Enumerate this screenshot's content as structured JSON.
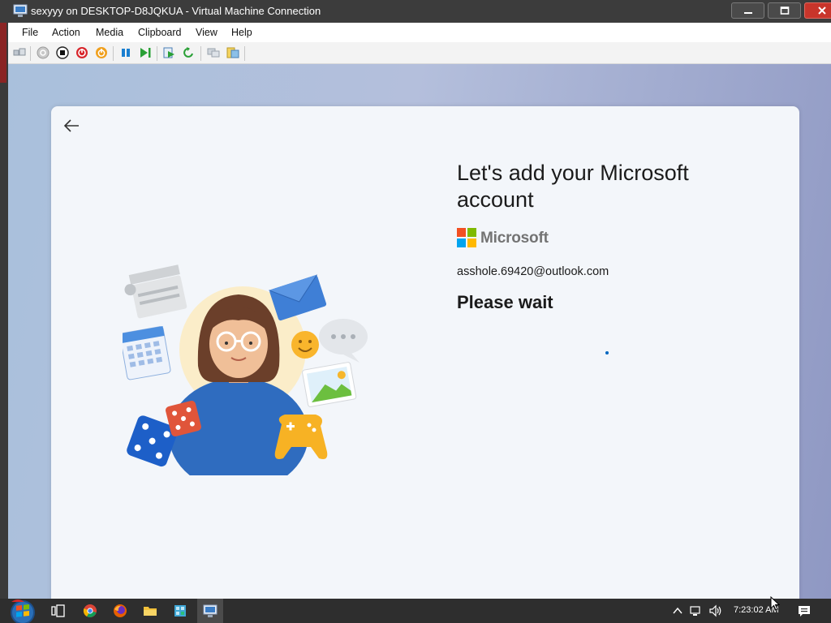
{
  "window": {
    "title": "sexyyy on DESKTOP-D8JQKUA - Virtual Machine Connection",
    "controls": [
      "minimize",
      "maximize",
      "close"
    ]
  },
  "menu": {
    "items": [
      {
        "label": "File"
      },
      {
        "label": "Action"
      },
      {
        "label": "Media"
      },
      {
        "label": "Clipboard"
      },
      {
        "label": "View"
      },
      {
        "label": "Help"
      }
    ]
  },
  "toolbar": {
    "buttons": [
      "ctrl-alt-del-icon",
      "start-icon",
      "turn-off-icon",
      "shutdown-icon",
      "save-state-icon",
      "pause-icon",
      "resume-icon",
      "checkpoint-icon",
      "revert-icon",
      "enhanced-session-icon",
      "share-icon"
    ]
  },
  "oobe": {
    "heading": "Let's add your Microsoft account",
    "brand": "Microsoft",
    "email": "asshole.69420@outlook.com",
    "status": "Please wait",
    "colors": {
      "ms_red": "#f25022",
      "ms_green": "#7fba00",
      "ms_blue": "#00a4ef",
      "ms_yellow": "#ffb900",
      "spinner": "#0067c0"
    }
  },
  "taskbar": {
    "apps": [
      "start-button",
      "task-view-icon",
      "chrome-icon",
      "firefox-icon",
      "file-explorer-icon",
      "app-icon",
      "vm-connection-icon"
    ],
    "tray": [
      "chevron-up-icon",
      "network-icon",
      "volume-icon"
    ],
    "clock": "7:23:02 AM",
    "notification": "action-center-icon"
  }
}
